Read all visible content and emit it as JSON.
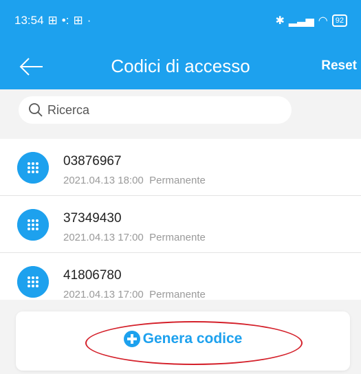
{
  "status_bar": {
    "time": "13:54",
    "battery": "92",
    "colors": {
      "bar": "#1da1ee"
    }
  },
  "header": {
    "title": "Codici di accesso",
    "reset_label": "Reset"
  },
  "search": {
    "placeholder": "Ricerca"
  },
  "codes": [
    {
      "code": "03876967",
      "date": "2021.04.13 18:00",
      "type": "Permanente"
    },
    {
      "code": "37349430",
      "date": "2021.04.13 17:00",
      "type": "Permanente"
    },
    {
      "code": "41806780",
      "date": "2021.04.13 17:00",
      "type": "Permanente"
    }
  ],
  "footer": {
    "generate_label": "Genera codice"
  },
  "icons": {
    "row": "keypad-icon",
    "back": "arrow-left-icon",
    "search": "search-icon",
    "generate": "plus-circle-icon"
  },
  "colors": {
    "accent": "#1da1ee",
    "highlight": "#d4202a"
  }
}
